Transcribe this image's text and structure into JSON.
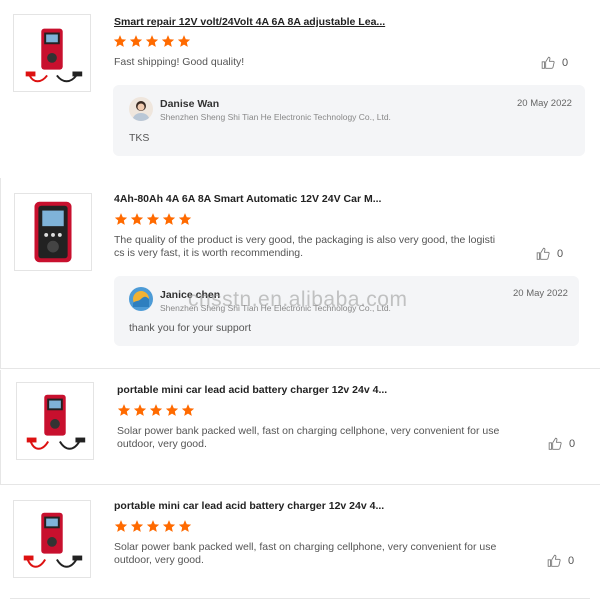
{
  "colors": {
    "star": "#ff6a00",
    "reply_bg": "#f4f5f7",
    "product_red": "#c8102e"
  },
  "icons": {
    "star": "star-icon",
    "like": "thumbs-up-icon",
    "product": "battery-charger-image"
  },
  "reviews": [
    {
      "title": "Smart repair 12V volt/24Volt 4A 6A 8A adjustable Lea...",
      "rating": 5,
      "text_lines": [
        "Fast shipping! Good quality!"
      ],
      "likes": "0",
      "reply": {
        "seller_name": "Danise Wan",
        "company": "Shenzhen Sheng Shi Tian He Electronic Technology Co., Ltd.",
        "date": "20 May 2022",
        "text": "TKS"
      }
    },
    {
      "title": "4Ah-80Ah 4A 6A 8A Smart Automatic 12V 24V Car M...",
      "rating": 5,
      "text_lines": [
        "The quality of the product is very good, the packaging is also very good, the logisti",
        "cs is very fast, it is worth recommending."
      ],
      "likes": "0",
      "reply": {
        "seller_name": "Janice chen",
        "company": "Shenzhen Sheng Shi Tian He Electronic Technology Co., Ltd.",
        "date": "20 May 2022",
        "text": "thank you for your support"
      }
    },
    {
      "title": "portable mini car lead acid battery charger 12v 24v 4...",
      "rating": 5,
      "text_lines": [
        "Solar power bank packed well, fast on charging cellphone, very convenient for use",
        "outdoor, very good."
      ],
      "likes": "0"
    },
    {
      "title": "portable mini car lead acid battery charger 12v 24v 4...",
      "rating": 5,
      "text_lines": [
        "Solar power bank packed well, fast on charging cellphone, very convenient for use",
        "outdoor, very good."
      ],
      "likes": "0"
    }
  ],
  "watermark": "cnsstn.en.alibaba.com"
}
